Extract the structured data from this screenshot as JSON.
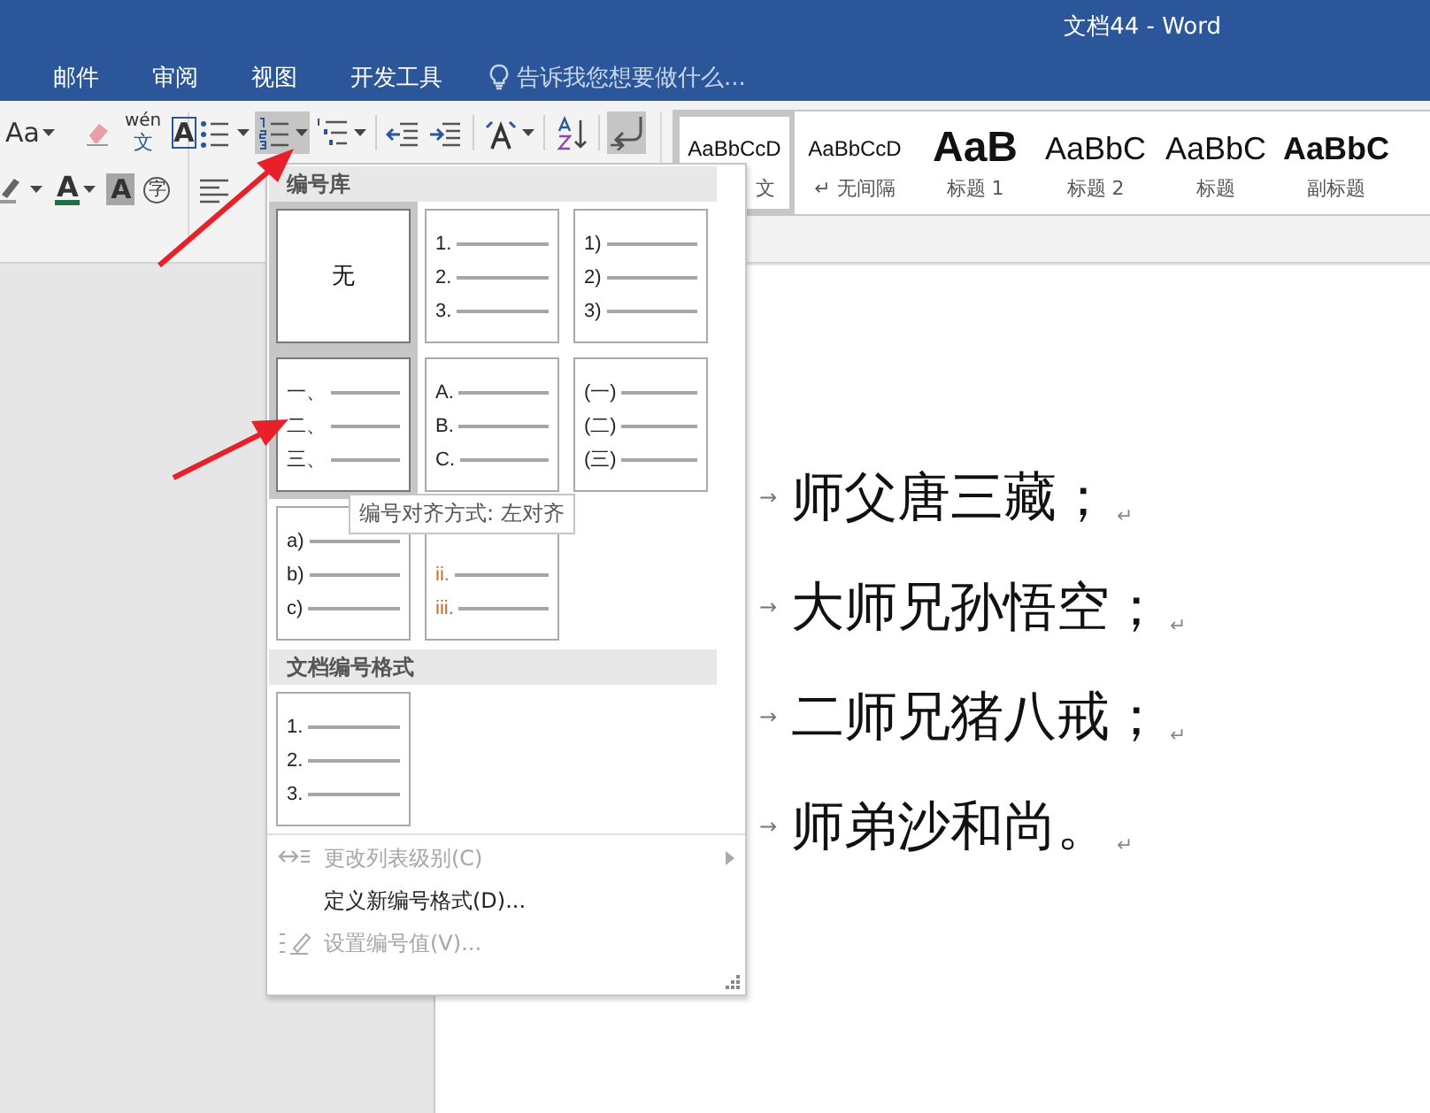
{
  "window": {
    "title": "文档44 - Word"
  },
  "tabs": [
    {
      "label": "邮件",
      "selected": false
    },
    {
      "label": "审阅",
      "selected": false
    },
    {
      "label": "视图",
      "selected": false
    },
    {
      "label": "开发工具",
      "selected": false
    }
  ],
  "tell_me": {
    "placeholder": "告诉我您想要做什么..."
  },
  "ribbon": {
    "change_case": "Aa",
    "phonetic_top": "wén",
    "phonetic_bottom": "文",
    "char_border": "A",
    "font_color": "A",
    "char_shading": "A",
    "enclose": "字",
    "paragraph_buttons": [
      {
        "kind": "bullets",
        "pressed": false
      },
      {
        "kind": "numbering",
        "pressed": true
      },
      {
        "kind": "multilevel",
        "pressed": false
      },
      {
        "kind": "outdent",
        "pressed": false
      },
      {
        "kind": "indent",
        "pressed": false
      },
      {
        "kind": "layout",
        "pressed": false
      },
      {
        "kind": "sort",
        "pressed": false
      },
      {
        "kind": "marks",
        "pressed": true
      }
    ]
  },
  "styles": [
    {
      "preview": "AaBbCcD",
      "name": "文",
      "kind": "normal",
      "selected": true
    },
    {
      "preview": "AaBbCcD",
      "name": "↵ 无间隔",
      "kind": "normal",
      "selected": false
    },
    {
      "preview": "AaB",
      "name": "标题 1",
      "kind": "heading1",
      "selected": false
    },
    {
      "preview": "AaBbC",
      "name": "标题 2",
      "kind": "heading2",
      "selected": false
    },
    {
      "preview": "AaBbC",
      "name": "标题",
      "kind": "title",
      "selected": false
    },
    {
      "preview": "AaBbC",
      "name": "副标题",
      "kind": "subtitle",
      "selected": false
    }
  ],
  "numbering_menu": {
    "library_title": "编号库",
    "library": [
      {
        "kind": "none",
        "label": "无",
        "highlighted": true
      },
      {
        "kind": "list",
        "markers": [
          "1.",
          "2.",
          "3."
        ],
        "color": "#222222",
        "highlighted": false
      },
      {
        "kind": "list",
        "markers": [
          "1)",
          "2)",
          "3)"
        ],
        "color": "#222222",
        "highlighted": false
      },
      {
        "kind": "list",
        "markers": [
          "一、",
          "二、",
          "三、"
        ],
        "color": "#222222",
        "highlighted": true
      },
      {
        "kind": "list",
        "markers": [
          "A.",
          "B.",
          "C."
        ],
        "color": "#222222",
        "highlighted": false
      },
      {
        "kind": "list",
        "markers": [
          "(一)",
          "(二)",
          "(三)"
        ],
        "color": "#222222",
        "highlighted": false
      },
      {
        "kind": "list",
        "markers": [
          "a)",
          "b)",
          "c)"
        ],
        "color": "#222222",
        "highlighted": false
      },
      {
        "kind": "list",
        "markers": [
          "ii.",
          "iii."
        ],
        "color": "#c0702a",
        "highlighted": false
      }
    ],
    "document_title": "文档编号格式",
    "document_formats": [
      {
        "kind": "list",
        "markers": [
          "1.",
          "2.",
          "3."
        ],
        "color": "#222222",
        "highlighted": false
      }
    ],
    "commands": [
      {
        "label": "更改列表级别(C)",
        "kind": "level",
        "disabled": true,
        "submenu": true
      },
      {
        "label": "定义新编号格式(D)...",
        "kind": "plain",
        "disabled": false,
        "submenu": false
      },
      {
        "label": "设置编号值(V)...",
        "kind": "value",
        "disabled": true,
        "submenu": false
      }
    ]
  },
  "tooltip": "编号对齐方式: 左对齐",
  "document": {
    "paragraphs": [
      {
        "tab_mark": "→",
        "text": "师父唐三藏；",
        "para_mark": "↵"
      },
      {
        "tab_mark": "→",
        "text": "大师兄孙悟空；",
        "para_mark": "↵"
      },
      {
        "tab_mark": "→",
        "text": "二师兄猪八戒；",
        "para_mark": "↵"
      },
      {
        "tab_mark": "→",
        "text": "师弟沙和尚。",
        "para_mark": "↵"
      }
    ]
  }
}
